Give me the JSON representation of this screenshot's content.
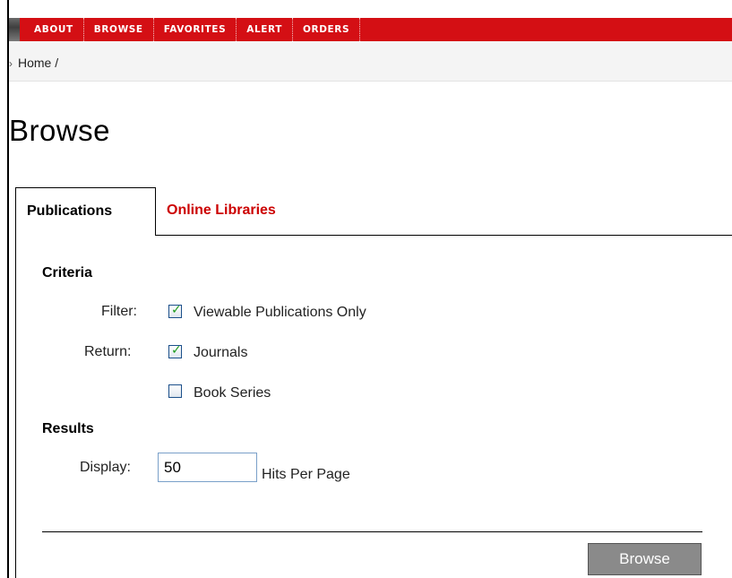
{
  "nav": {
    "items": [
      {
        "label": "ABOUT"
      },
      {
        "label": "BROWSE"
      },
      {
        "label": "FAVORITES"
      },
      {
        "label": "ALERT"
      },
      {
        "label": "ORDERS"
      }
    ],
    "bar_color": "#d40f14"
  },
  "breadcrumb": {
    "separator": "›",
    "text": "Home /"
  },
  "page": {
    "title": "Browse"
  },
  "tabs": [
    {
      "label": "Publications",
      "active": true
    },
    {
      "label": "Online Libraries",
      "active": false,
      "color": "#cc0000"
    }
  ],
  "criteria": {
    "heading": "Criteria",
    "filter_label": "Filter:",
    "filter_option": {
      "label": "Viewable Publications Only",
      "checked": true
    },
    "return_label": "Return:",
    "return_options": [
      {
        "label": "Journals",
        "checked": true
      },
      {
        "label": "Book Series",
        "checked": false
      }
    ]
  },
  "results": {
    "heading": "Results",
    "display_label": "Display:",
    "display_value": "50",
    "hits_label": "Hits Per Page"
  },
  "actions": {
    "browse_label": "Browse"
  }
}
